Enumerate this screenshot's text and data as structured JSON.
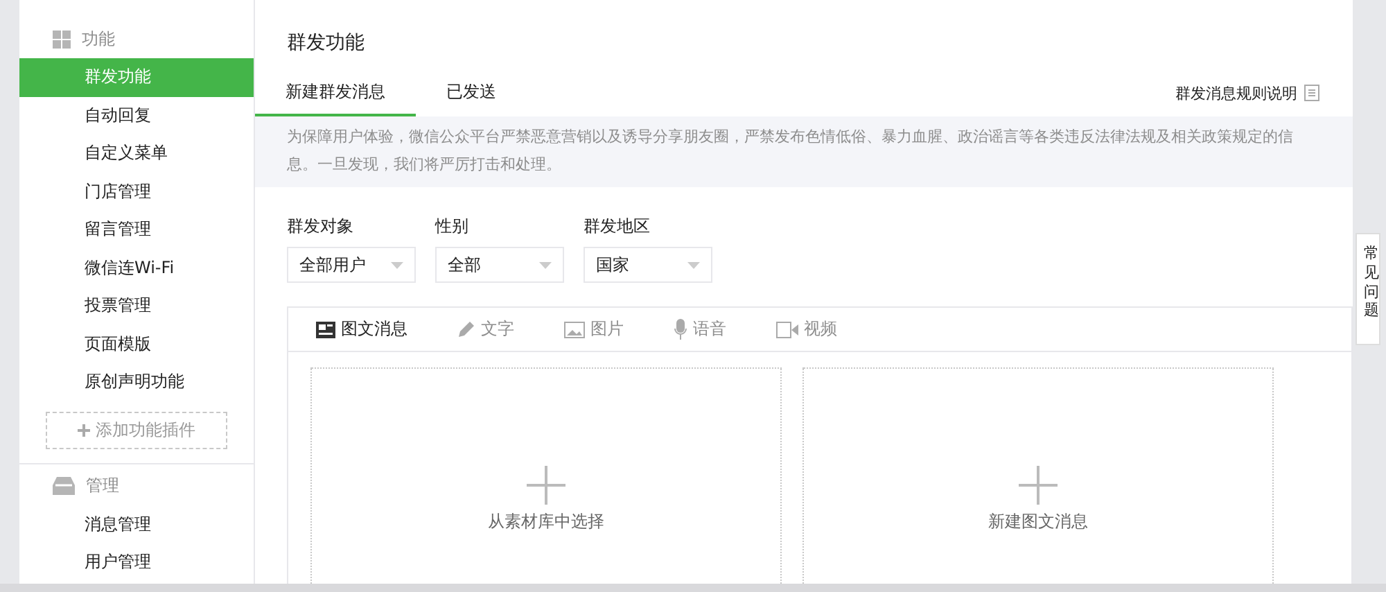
{
  "sidebar": {
    "sections": [
      {
        "kind": "grid",
        "title": "功能",
        "items": [
          {
            "label": "群发功能",
            "selected": true
          },
          {
            "label": "自动回复",
            "selected": false
          },
          {
            "label": "自定义菜单",
            "selected": false
          },
          {
            "label": "门店管理",
            "selected": false
          },
          {
            "label": "留言管理",
            "selected": false
          },
          {
            "label": "微信连Wi-Fi",
            "selected": false
          },
          {
            "label": "投票管理",
            "selected": false
          },
          {
            "label": "页面模版",
            "selected": false
          },
          {
            "label": "原创声明功能",
            "selected": false
          }
        ],
        "add_button": "添加功能插件"
      },
      {
        "kind": "tray",
        "title": "管理",
        "items": [
          {
            "label": "消息管理",
            "selected": false
          },
          {
            "label": "用户管理",
            "selected": false
          }
        ]
      }
    ]
  },
  "page_title": "群发功能",
  "tabs": [
    {
      "label": "新建群发消息",
      "selected": true
    },
    {
      "label": "已发送",
      "selected": false
    }
  ],
  "rules_link": "群发消息规则说明",
  "notice": "为保障用户体验，微信公众平台严禁恶意营销以及诱导分享朋友圈，严禁发布色情低俗、暴力血腥、政治谣言等各类违反法律法规及相关政策规定的信息。一旦发现，我们将严厉打击和处理。",
  "filters": [
    {
      "label": "群发对象",
      "value": "全部用户"
    },
    {
      "label": "性别",
      "value": "全部"
    },
    {
      "label": "群发地区",
      "value": "国家"
    }
  ],
  "message_types": [
    {
      "kind": "news",
      "label": "图文消息",
      "selected": true
    },
    {
      "kind": "text",
      "label": "文字",
      "selected": false
    },
    {
      "kind": "image",
      "label": "图片",
      "selected": false
    },
    {
      "kind": "voice",
      "label": "语音",
      "selected": false
    },
    {
      "kind": "video",
      "label": "视频",
      "selected": false
    }
  ],
  "options": [
    "从素材库中选择",
    "新建图文消息"
  ],
  "help_widget": "常见问题"
}
